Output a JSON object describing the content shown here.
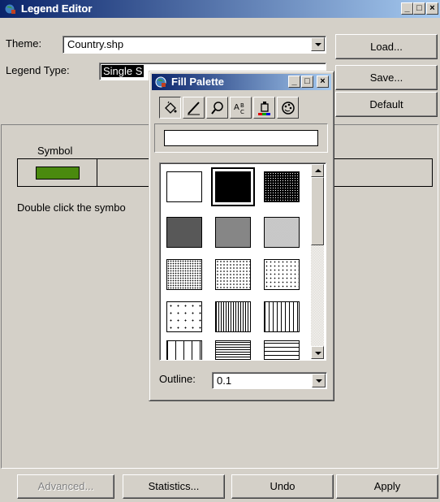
{
  "legend_editor": {
    "title": "Legend Editor",
    "theme_label": "Theme:",
    "theme_value": "Country.shp",
    "legend_type_label": "Legend Type:",
    "legend_type_value": "Single S",
    "load_button": "Load...",
    "save_button": "Save...",
    "default_button": "Default",
    "symbol_header": "Symbol",
    "symbol_color": "#4a8a0e",
    "hint_text": "Double click the symbo",
    "advanced_button": "Advanced...",
    "statistics_button": "Statistics...",
    "undo_button": "Undo",
    "apply_button": "Apply",
    "caption_minimize": "_",
    "caption_maximize": "□",
    "caption_close": "×"
  },
  "fill_palette": {
    "title": "Fill Palette",
    "tools": [
      "fill-bucket-icon",
      "pen-icon",
      "marker-icon",
      "text-icon",
      "color-icon",
      "palette-icon"
    ],
    "name_value": "",
    "outline_label": "Outline:",
    "outline_value": "0.1",
    "swatches": [
      "blank",
      "solid",
      "dense-dots-1",
      "dense-dots-2",
      "dense-dots-3",
      "dense-dots-4",
      "medium-dots",
      "sparse-dots",
      "sparser-dots",
      "very-sparse-dots",
      "dense-vertical",
      "vertical-lines",
      "wide-vertical",
      "dense-horizontal",
      "horizontal-lines"
    ],
    "selected_swatch": 1
  }
}
